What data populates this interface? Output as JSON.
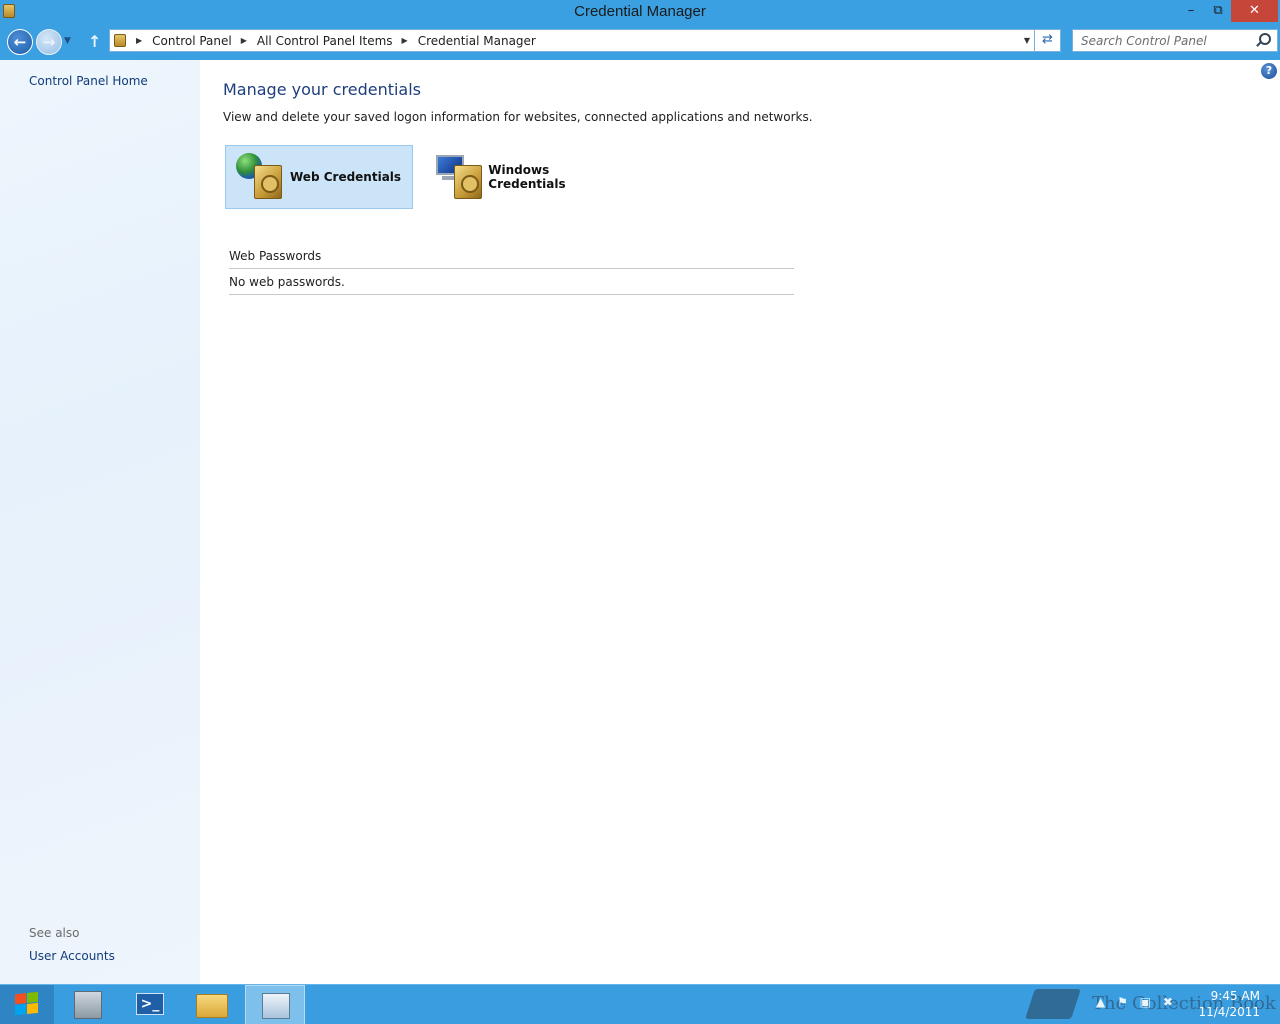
{
  "window": {
    "title": "Credential Manager",
    "minimize_glyph": "–",
    "maximize_glyph": "⧉",
    "close_glyph": "✕"
  },
  "address": {
    "crumbs": [
      "Control Panel",
      "All Control Panel Items",
      "Credential Manager"
    ],
    "refresh_glyph": "⇄"
  },
  "search": {
    "placeholder": "Search Control Panel"
  },
  "left_pane": {
    "home_link": "Control Panel Home",
    "see_also": "See also",
    "links": [
      "User Accounts"
    ]
  },
  "main": {
    "heading": "Manage your credentials",
    "description": "View and delete your saved logon information for websites, connected applications and networks.",
    "tiles": [
      {
        "label": "Web Credentials",
        "selected": true,
        "icon": "web-vault-icon"
      },
      {
        "label": "Windows Credentials",
        "selected": false,
        "icon": "windows-vault-icon"
      }
    ],
    "section_title": "Web Passwords",
    "empty_message": "No web passwords.",
    "help_glyph": "?"
  },
  "taskbar": {
    "apps": [
      "server-manager-icon",
      "powershell-icon",
      "file-explorer-icon",
      "control-panel-icon"
    ],
    "active_app": "control-panel-icon",
    "powershell_glyph": ">_",
    "tray_icons": [
      "show-hidden-icons-icon",
      "flag-icon",
      "network-icon",
      "volume-muted-icon"
    ],
    "time": "9:45 AM",
    "date": "11/4/2011",
    "watermark": "The Collection Book"
  },
  "colors": {
    "title_bar": "#3aa0e2",
    "close_button": "#c7463a",
    "link": "#123c7a",
    "heading": "#1e3e7b",
    "selected_tile": "#cce4f7"
  }
}
